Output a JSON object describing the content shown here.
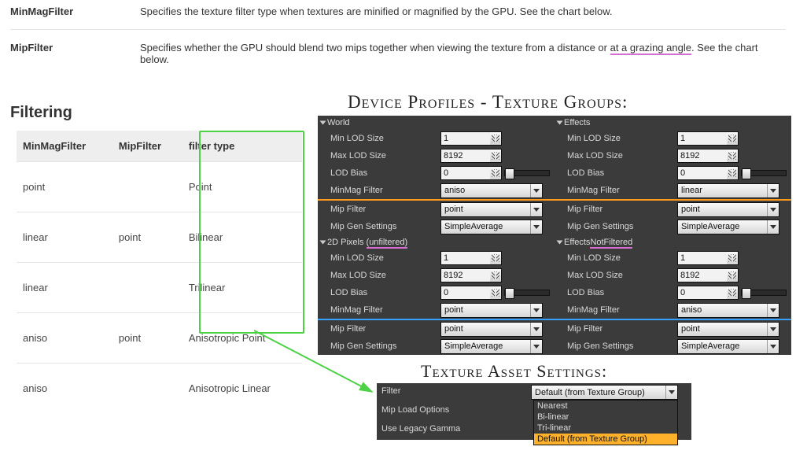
{
  "defs": {
    "minmag": {
      "name": "MinMagFilter",
      "desc": "Specifies the texture filter type when textures are minified or magnified by the GPU. See the chart below."
    },
    "mip": {
      "name": "MipFilter",
      "desc_pre": "Specifies whether the GPU should blend two mips together when viewing the texture from a distance or ",
      "desc_hl": "at a grazing angle",
      "desc_post": ". See the chart below."
    }
  },
  "sect_title": "Filtering",
  "table": {
    "headers": [
      "MinMagFilter",
      "MipFilter",
      "filter type"
    ],
    "rows": [
      [
        "point",
        "",
        "Point"
      ],
      [
        "linear",
        "point",
        "Bilinear"
      ],
      [
        "linear",
        "",
        "Trilinear"
      ],
      [
        "aniso",
        "point",
        "Anisotropic Point"
      ],
      [
        "aniso",
        "",
        "Anisotropic Linear"
      ]
    ]
  },
  "heading_dp": "Device Profiles - Texture Groups:",
  "heading_tas": "Texture Asset Settings:",
  "dp": {
    "labels": {
      "minlod": "Min LOD Size",
      "maxlod": "Max LOD Size",
      "lodbias": "LOD Bias",
      "minmag": "MinMag Filter",
      "mip": "Mip Filter",
      "mipgen": "Mip Gen Settings"
    },
    "groups": [
      {
        "name": "World",
        "minlod": "1",
        "maxlod": "8192",
        "lodbias": "0",
        "minmag": "aniso",
        "mip": "point",
        "mipgen": "SimpleAverage"
      },
      {
        "name": "Effects",
        "minlod": "1",
        "maxlod": "8192",
        "lodbias": "0",
        "minmag": "linear",
        "mip": "point",
        "mipgen": "SimpleAverage"
      },
      {
        "name_pre": "2D Pixels ",
        "name_hl": "(unfiltered)",
        "minlod": "1",
        "maxlod": "8192",
        "lodbias": "0",
        "minmag": "point",
        "mip": "point",
        "mipgen": "SimpleAverage"
      },
      {
        "name_pre": "Effects",
        "name_hl": "NotFiltered",
        "minlod": "1",
        "maxlod": "8192",
        "lodbias": "0",
        "minmag": "aniso",
        "mip": "point",
        "mipgen": "SimpleAverage"
      }
    ]
  },
  "tas": {
    "labels": {
      "filter": "Filter",
      "miploadoptions": "Mip Load Options",
      "uselegacygamma": "Use Legacy Gamma"
    },
    "filter_value": "Default (from Texture Group)",
    "options": [
      "Nearest",
      "Bi-linear",
      "Tri-linear",
      "Default (from Texture Group)"
    ]
  }
}
